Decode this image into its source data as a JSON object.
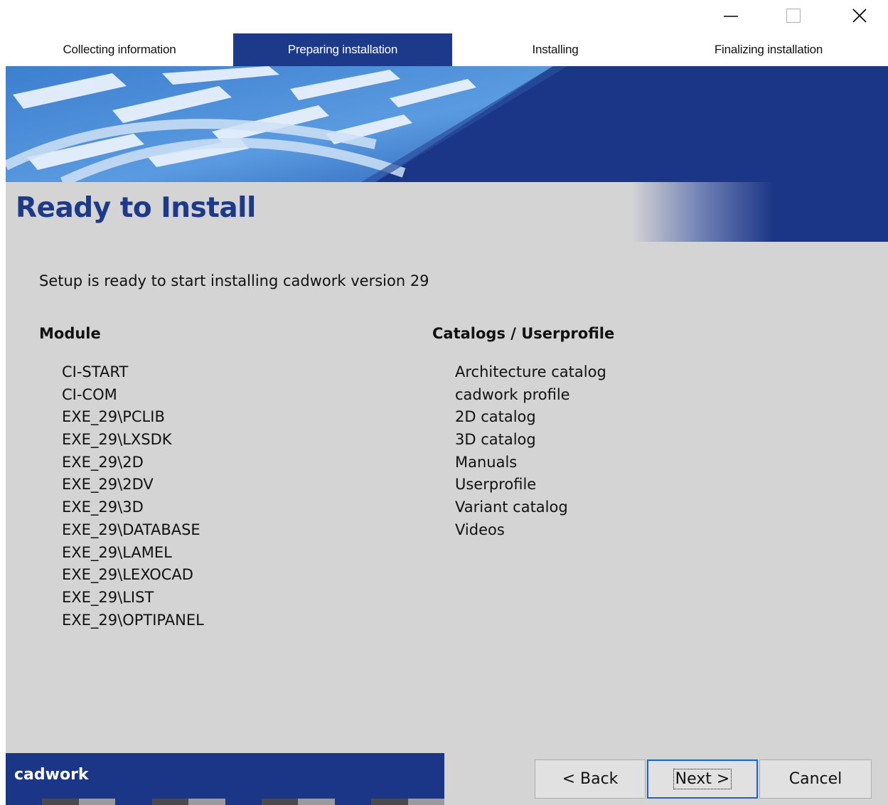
{
  "window_controls": {
    "minimize_icon": "minimize-icon",
    "maximize_icon": "maximize-icon",
    "close_icon": "close-icon"
  },
  "steps": [
    {
      "label": "Collecting information",
      "active": false
    },
    {
      "label": "Preparing installation",
      "active": true
    },
    {
      "label": "Installing",
      "active": false
    },
    {
      "label": "Finalizing installation",
      "active": false
    }
  ],
  "page": {
    "title": "Ready to Install",
    "intro": "Setup is ready to start installing cadwork version 29"
  },
  "modules": {
    "heading": "Module",
    "items": [
      "CI-START",
      "CI-COM",
      "EXE_29\\PCLIB",
      "EXE_29\\LXSDK",
      "EXE_29\\2D",
      "EXE_29\\2DV",
      "EXE_29\\3D",
      "EXE_29\\DATABASE",
      "EXE_29\\LAMEL",
      "EXE_29\\LEXOCAD",
      "EXE_29\\LIST",
      "EXE_29\\OPTIPANEL"
    ]
  },
  "catalogs": {
    "heading": "Catalogs / Userprofile",
    "items": [
      "Architecture catalog",
      "cadwork profile",
      "2D catalog",
      "3D catalog",
      "Manuals",
      "Userprofile",
      "Variant catalog",
      "Videos"
    ]
  },
  "footer": {
    "brand": "cadwork",
    "back_label": "< Back",
    "next_label": "Next >",
    "cancel_label": "Cancel"
  },
  "colors": {
    "accent": "#1d3a8a",
    "panel": "#d4d4d4",
    "focus": "#1b63c6"
  }
}
